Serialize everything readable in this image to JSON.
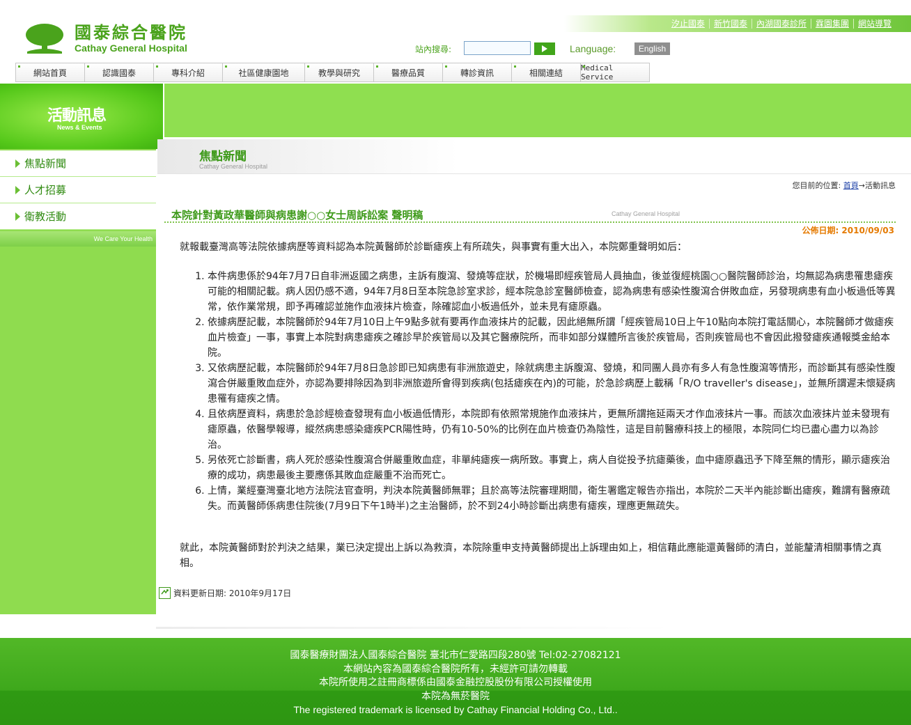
{
  "header": {
    "logo_zh": "國泰綜合醫院",
    "logo_en": "Cathay General Hospital",
    "top_links": [
      "汐止國泰",
      "新竹國泰",
      "內湖國泰診所",
      "霖園集團",
      "網站導覽"
    ],
    "search_label": "站內搜尋:",
    "search_value": "",
    "language_label": "Language:",
    "english_button": "English"
  },
  "nav": {
    "items": [
      "網站首頁",
      "認識國泰",
      "專科介紹",
      "社區健康園地",
      "教學與研究",
      "醫療品質",
      "轉診資訊",
      "相關連結",
      "Medical Service"
    ]
  },
  "sidebar": {
    "banner_zh": "活動訊息",
    "banner_en": "News & Events",
    "items": [
      "焦點新聞",
      "人才招募",
      "衛教活動"
    ],
    "tagline": "We Care Your Health"
  },
  "section": {
    "title": "焦點新聞",
    "subtitle": "Cathay General Hospital"
  },
  "breadcrumb": {
    "prefix": "您目前的位置:",
    "home": "首頁",
    "arrow": "→",
    "current": "活動訊息"
  },
  "article": {
    "title": "本院針對黃政華醫師與病患謝○○女士周訴訟案 聲明稿",
    "watermark": "Cathay General Hospital",
    "publish_date": "公佈日期: 2010/09/03",
    "intro": "就報載臺灣高等法院依據病歷等資料認為本院黃醫師於診斷瘧疾上有所疏失，與事實有重大出入，本院鄭重聲明如后：",
    "items": [
      "本件病患係於94年7月7日自非洲返國之病患，主訴有腹瀉、發燒等症狀，於機場即經疾管局人員抽血，後並復經桃園○○醫院醫師診治，均無認為病患罹患瘧疾可能的相關記載。病人因仍感不適，94年7月8日至本院急診室求診，經本院急診室醫師檢查，認為病患有感染性腹瀉合併敗血症，另發現病患有血小板過低等異常，依作業常規，即予再確認並施作血液抹片檢查，除確認血小板過低外，並未見有瘧原蟲。",
      "依據病歷記載，本院醫師於94年7月10日上午9點多就有要再作血液抹片的記載，因此絕無所謂「經疾管局10日上午10點向本院打電話關心，本院醫師才做瘧疾血片檢查」一事，事實上本院對病患瘧疾之確診早於疾管局以及其它醫療院所，而非如部分媒體所言後於疾管局，否則疾管局也不會因此撥發瘧疾通報獎金給本院。",
      "又依病歷記載，本院醫師於94年7月8日急診即已知病患有非洲旅遊史，除就病患主訴腹瀉、發燒，和同團人員亦有多人有急性腹瀉等情形，而診斷其有感染性腹瀉合併嚴重敗血症外，亦認為要排除因為到非洲旅遊所會得到疾病(包括瘧疾在內)的可能，於急診病歷上載稱「R/O traveller's disease」，並無所謂遲未懷疑病患罹有瘧疾之情。",
      "且依病歷資料，病患於急診經檢查發現有血小板過低情形，本院即有依照常規施作血液抹片，更無所謂拖延兩天才作血液抹片一事。而該次血液抹片並未發現有瘧原蟲，依醫學報導，縱然病患感染瘧疾PCR陽性時，仍有10-50%的比例在血片檢查仍為陰性，這是目前醫療科技上的極限，本院同仁均已盡心盡力以為診治。",
      "另依死亡診斷書，病人死於感染性腹瀉合併嚴重敗血症，非單純瘧疾一病所致。事實上，病人自從投予抗瘧藥後，血中瘧原蟲迅予下降至無的情形，顯示瘧疾治療的成功，病患最後主要應係其敗血症嚴重不治而死亡。",
      "上情，業經臺灣臺北地方法院法官查明，判決本院黃醫師無罪；且於高等法院審理期間，衛生署鑑定報告亦指出，本院於二天半內能診斷出瘧疾，難謂有醫療疏失。而黃醫師係病患住院後(7月9日下午1時半)之主治醫師，於不到24小時診斷出病患有瘧疾，理應更無疏失。"
    ],
    "conclusion": "就此，本院黃醫師對於判決之結果，業已決定提出上訴以為救濟，本院除重申支持黃醫師提出上訴理由如上，相信藉此應能還黃醫師的清白，並能釐清相關事情之真相。"
  },
  "update_info": "資料更新日期: 2010年9月17日",
  "footer": {
    "lines": [
      "國泰醫療財團法人國泰綜合醫院 臺北市仁愛路四段280號 Tel:02-27082121",
      "本網站內容為國泰綜合醫院所有，未經許可請勿轉載",
      "本院所使用之註冊商標係由國泰金融控股股份有限公司授權使用",
      "本院為無菸醫院",
      "The registered trademark is licensed by Cathay Financial Holding Co., Ltd.."
    ]
  },
  "colors": {
    "brand_green": "#4aa31c",
    "sidebar_green": "#8fdc4f",
    "footer_green": "#3ea81c",
    "date_orange": "#e57a00"
  }
}
